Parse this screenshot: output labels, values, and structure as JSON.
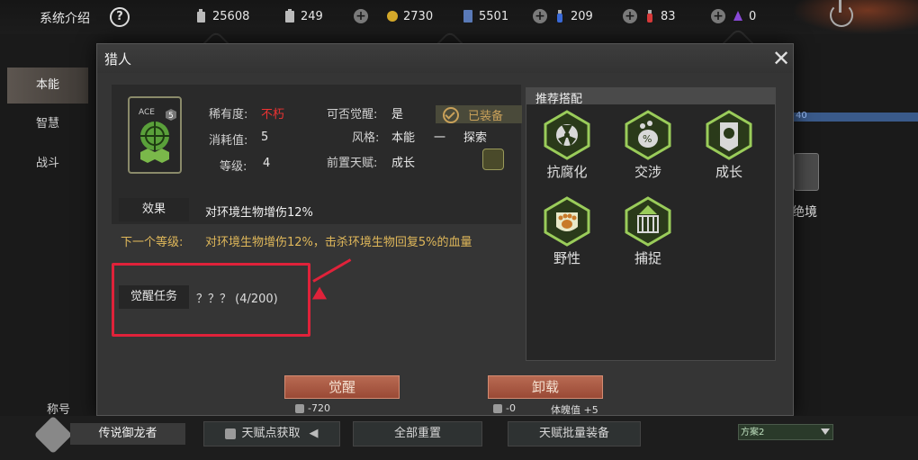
{
  "topbar": {
    "title": "系统介绍",
    "help_icon": "?",
    "resources": [
      {
        "icon": "fuel-icon",
        "value": "25608"
      },
      {
        "icon": "battery-icon",
        "value": "249"
      },
      {
        "icon": "coin-icon",
        "value": "2730"
      },
      {
        "icon": "card-icon",
        "value": "5501"
      },
      {
        "icon": "blue-potion-icon",
        "value": "209"
      },
      {
        "icon": "red-potion-icon",
        "value": "83"
      },
      {
        "icon": "purple-crystal-icon",
        "value": "0"
      }
    ]
  },
  "sidebar": {
    "items": [
      {
        "label": "本能"
      },
      {
        "label": "智慧"
      },
      {
        "label": "战斗"
      }
    ]
  },
  "background": {
    "label_40": "40",
    "side_label": "绝境"
  },
  "modal": {
    "title": "猎人",
    "rarity_label": "稀有度:",
    "rarity_value": "不朽",
    "cost_label": "消耗值:",
    "cost_value": "5",
    "level_label": "等级:",
    "level_value": "4",
    "awakenable_label": "可否觉醒:",
    "awakenable_value": "是",
    "equipped_label": "已装备",
    "style_label": "风格:",
    "style_value_1": "本能",
    "style_sep": "一",
    "style_value_2": "探索",
    "prereq_label": "前置天赋:",
    "prereq_value": "成长",
    "icon_badge": "5",
    "icon_text": "ACE",
    "effect_label": "效果",
    "effect_text": "对环境生物增伤12%",
    "next_level_label": "下一个等级:",
    "next_level_text": "对环境生物增伤12%，击杀环境生物回复5%的血量",
    "awaken_task_label": "觉醒任务",
    "awaken_task_value": "？？？ (4/200)",
    "recommend": {
      "title": "推荐搭配",
      "items": [
        {
          "label": "抗腐化",
          "icon": "radiation-icon"
        },
        {
          "label": "交涉",
          "icon": "trade-icon"
        },
        {
          "label": "成长",
          "icon": "growth-icon"
        },
        {
          "label": "野性",
          "icon": "paw-icon"
        },
        {
          "label": "捕捉",
          "icon": "capture-icon"
        }
      ]
    },
    "awaken_button": "觉醒",
    "awaken_cost": "-720",
    "unequip_button": "卸载",
    "unequip_cost": "-0",
    "unequip_extra": "体魄值 +5"
  },
  "bottom": {
    "title_label": "称号",
    "title_name": "传说御龙者",
    "talent_points_btn": "天赋点获取",
    "reset_btn": "全部重置",
    "batch_equip_btn": "天赋批量装备",
    "scheme_value": "方案2"
  }
}
